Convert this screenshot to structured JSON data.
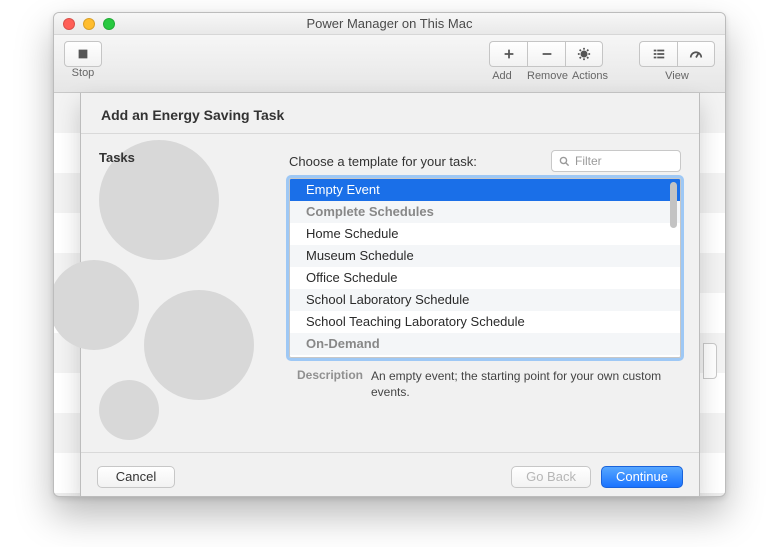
{
  "window": {
    "title": "Power Manager on This Mac"
  },
  "toolbar": {
    "stop": "Stop",
    "add": "Add",
    "remove": "Remove",
    "actions": "Actions",
    "view": "View"
  },
  "sheet": {
    "title": "Add an Energy Saving Task",
    "sidebar_label": "Tasks",
    "choose_label": "Choose a template for your task:",
    "filter_placeholder": "Filter",
    "items": [
      {
        "label": "Empty Event",
        "kind": "item",
        "selected": true
      },
      {
        "label": "Complete Schedules",
        "kind": "header"
      },
      {
        "label": "Home Schedule",
        "kind": "item"
      },
      {
        "label": "Museum Schedule",
        "kind": "item"
      },
      {
        "label": "Office Schedule",
        "kind": "item"
      },
      {
        "label": "School Laboratory Schedule",
        "kind": "item"
      },
      {
        "label": "School Teaching Laboratory Schedule",
        "kind": "item"
      },
      {
        "label": "On-Demand",
        "kind": "header"
      }
    ],
    "description_label": "Description",
    "description_text": "An empty event; the starting point for your own custom events.",
    "buttons": {
      "cancel": "Cancel",
      "back": "Go Back",
      "continue": "Continue"
    }
  }
}
